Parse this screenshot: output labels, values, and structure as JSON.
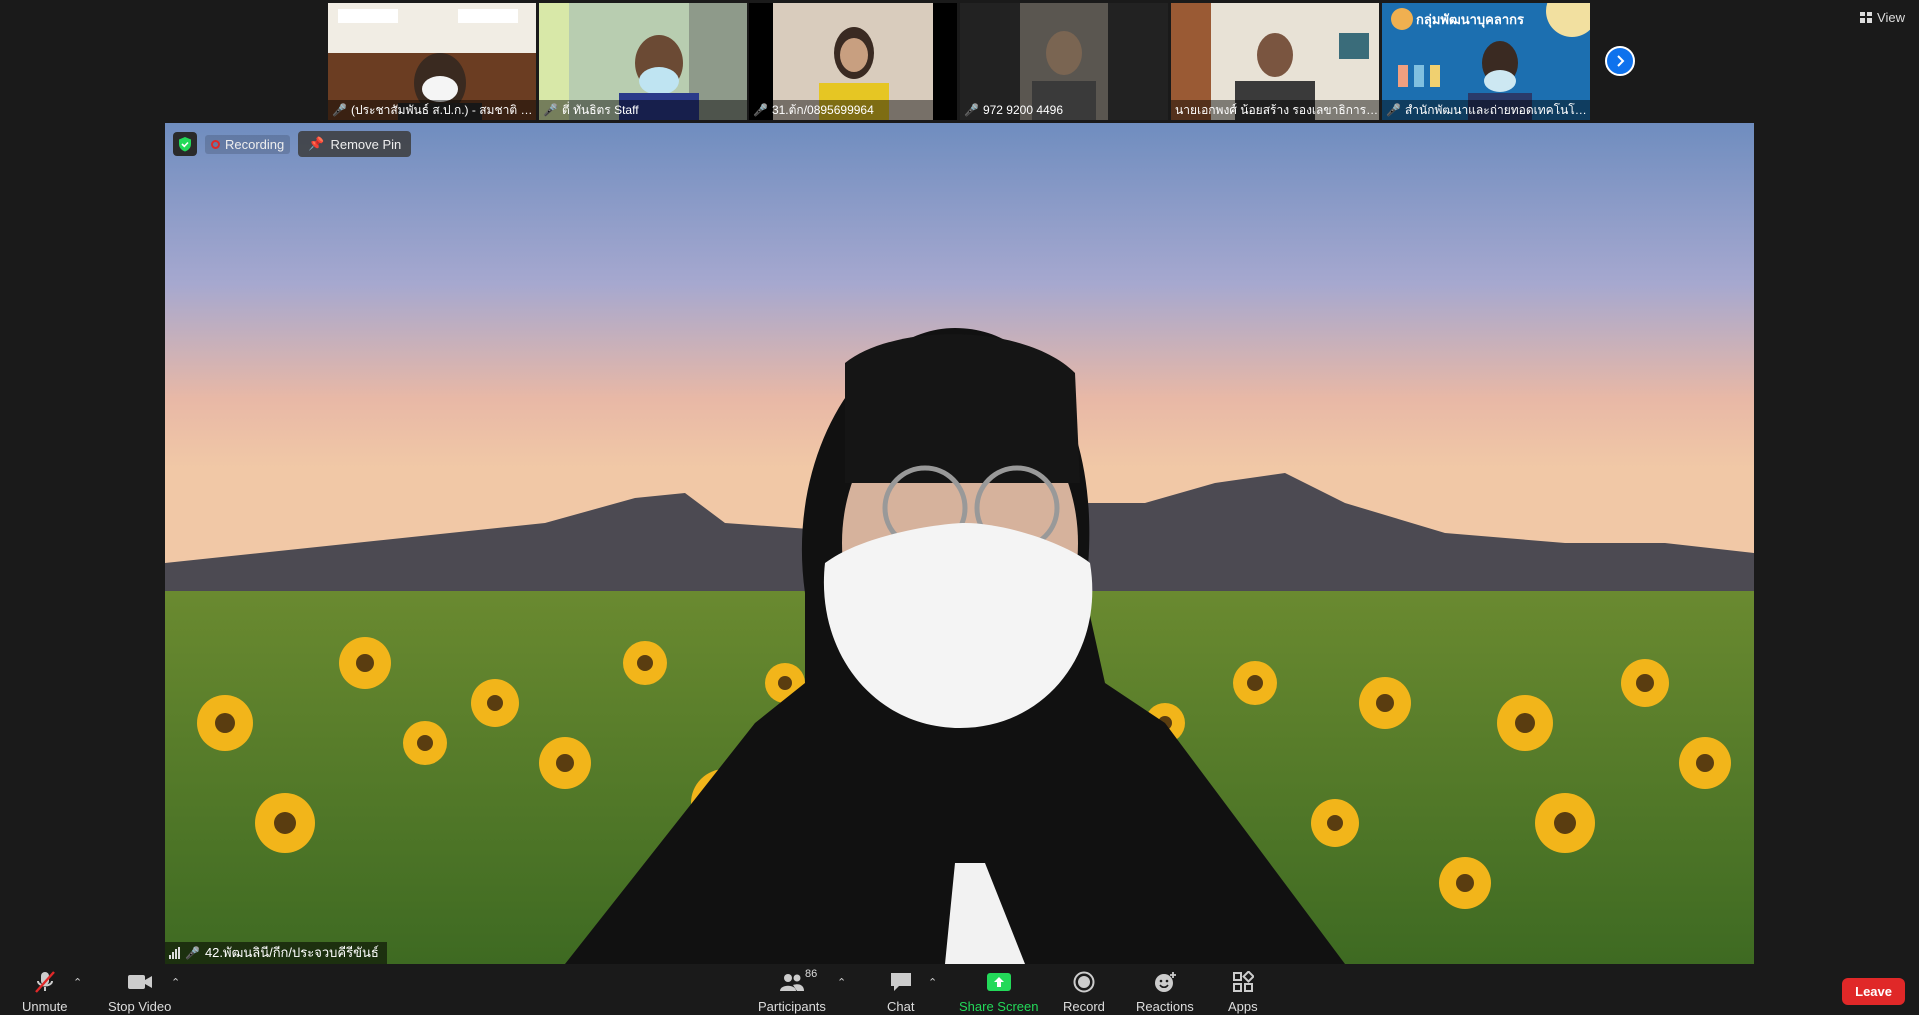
{
  "thumbnails": [
    {
      "name": "(ประชาสัมพันธ์ ส.ป.ก.) - สมชาติ จ...",
      "bg": "#6b4a2e"
    },
    {
      "name": "ตี่ ทันธิตร Staff",
      "bg": "#8aa08a"
    },
    {
      "name": "31.ต้ก/0895699964",
      "bg": "#d8cbbb"
    },
    {
      "name": "972 9200 4496",
      "bg": "#5a5650"
    },
    {
      "name": "นายเอกพงศ์ น้อยสร้าง รองเลขาธิการ ส...",
      "bg": "#b88a5a"
    },
    {
      "name": "สำนักพัฒนาและถ่ายทอดเทคโนโลยี ...",
      "bg": "#1c6fb0",
      "banner": "กลุ่มพัฒนาบุคลากร"
    }
  ],
  "view_label": "View",
  "main": {
    "recording_label": "Recording",
    "remove_pin_label": "Remove Pin",
    "speaker_name": "42.พัฒนลินี/กีก/ประจวบคีรีขันธ์"
  },
  "toolbar": {
    "unmute": "Unmute",
    "stop_video": "Stop Video",
    "participants": "Participants",
    "participants_count": "86",
    "chat": "Chat",
    "share_screen": "Share Screen",
    "record": "Record",
    "reactions": "Reactions",
    "apps": "Apps",
    "leave": "Leave"
  },
  "colors": {
    "accent": "#0e72ed",
    "share_green": "#23d959",
    "leave_red": "#e02828",
    "muted_red": "#e02828"
  }
}
